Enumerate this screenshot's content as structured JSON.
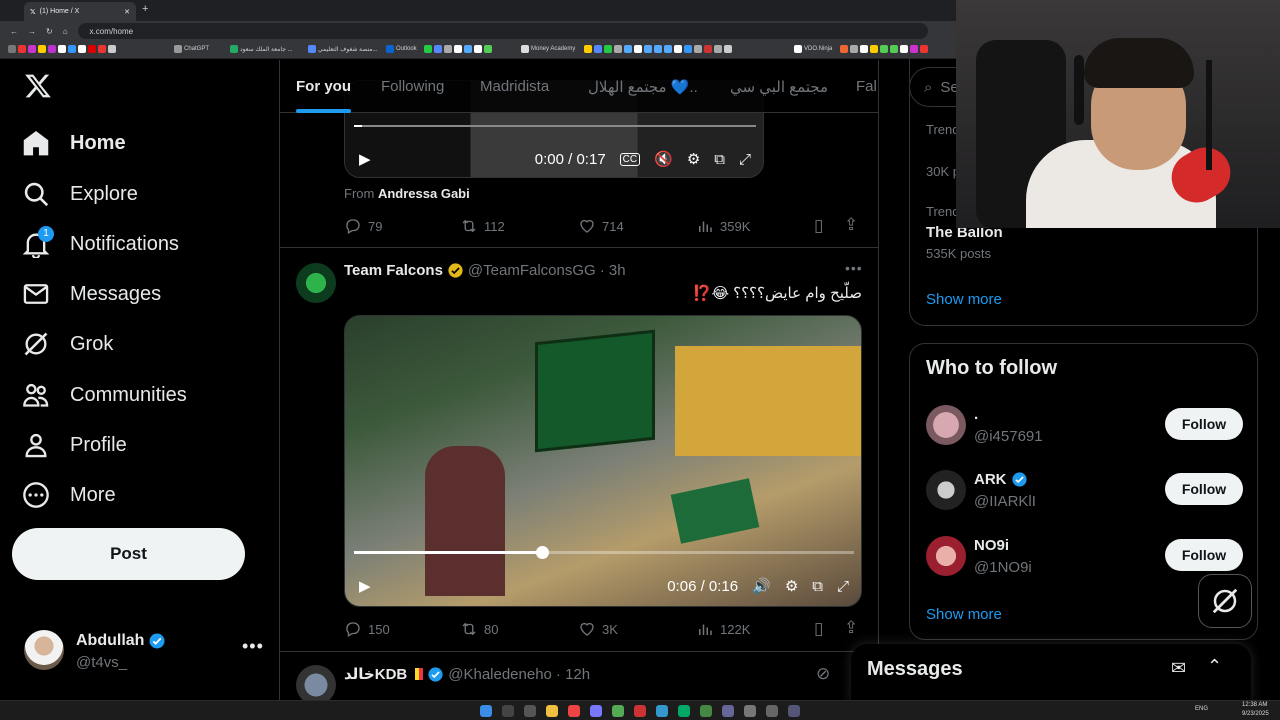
{
  "browser": {
    "tab_title": "(1) Home / X",
    "url": "x.com/home",
    "bookmarks": [
      "ChatGPT",
      "جامعة الملك سعود ...",
      "منصة شغوف التعليمي...",
      "Outlook",
      "Money Academy",
      "VDO.Ninja"
    ]
  },
  "nav": {
    "items": [
      {
        "label": "Home",
        "icon": "home-icon"
      },
      {
        "label": "Explore",
        "icon": "search-icon"
      },
      {
        "label": "Notifications",
        "icon": "bell-icon",
        "badge": "1"
      },
      {
        "label": "Messages",
        "icon": "mail-icon"
      },
      {
        "label": "Grok",
        "icon": "grok-icon"
      },
      {
        "label": "Communities",
        "icon": "people-icon"
      },
      {
        "label": "Profile",
        "icon": "person-icon"
      },
      {
        "label": "More",
        "icon": "more-circle-icon"
      }
    ],
    "post_label": "Post",
    "account": {
      "name": "Abdullah",
      "handle": "@t4vs_"
    }
  },
  "timeline": {
    "tabs": [
      "For you",
      "Following",
      "Madridista",
      "مجتمع الهلال 💙..",
      "مجتمع البي سي",
      "Fal"
    ],
    "post1": {
      "video_time": "0:00 / 0:17",
      "from_prefix": "From",
      "from_name": "Andressa Gabi",
      "replies": "79",
      "reposts": "112",
      "likes": "714",
      "views": "359K"
    },
    "post2": {
      "name": "Team Falcons",
      "handle": "@TeamFalconsGG",
      "time": "· 3h",
      "text": "صلّيح وام عايض؟؟؟؟ 😂⁉️",
      "video_time": "0:06 / 0:16",
      "progress": 0.375,
      "replies": "150",
      "reposts": "80",
      "likes": "3K",
      "views": "122K"
    },
    "post3": {
      "name": "خالدKDB",
      "handle": "@Khaledeneho",
      "time": "· 12h"
    }
  },
  "sidebar": {
    "search_placeholder": "Se",
    "trend1_meta": "Trend",
    "trend1_count": "30K p",
    "trend2_meta": "Trend",
    "trend2_title": "The Ballon",
    "trend2_count": "535K posts",
    "show_more": "Show more",
    "who_to_follow_title": "Who to follow",
    "follow_label": "Follow",
    "suggestions": [
      {
        "name": ".",
        "handle": "@i457691"
      },
      {
        "name": "ARK",
        "handle": "@IIARKlI"
      },
      {
        "name": "NO9i",
        "handle": "@1NO9i"
      }
    ],
    "show_more_2": "Show more"
  },
  "messages_drawer": {
    "title": "Messages"
  },
  "taskbar": {
    "lang": "ENG",
    "time": "12:38 AM",
    "date": "9/23/2025"
  },
  "colors": {
    "accent": "#1d9bf0",
    "verified": "#1d9bf0",
    "background": "#000000",
    "border": "#2f3336"
  }
}
